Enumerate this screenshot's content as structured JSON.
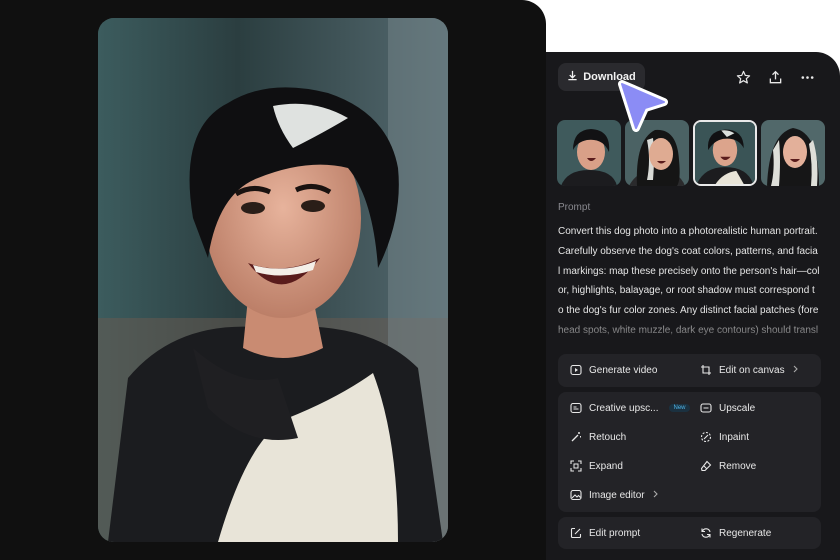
{
  "toolbar": {
    "download_label": "Download",
    "icons": [
      "star-icon",
      "share-icon",
      "more-icon"
    ]
  },
  "thumbnails": [
    {
      "name": "variation-1",
      "selected": false
    },
    {
      "name": "variation-2",
      "selected": false
    },
    {
      "name": "variation-3",
      "selected": true
    },
    {
      "name": "variation-4",
      "selected": false
    }
  ],
  "prompt": {
    "label": "Prompt",
    "text": "Convert this dog photo into a photorealistic human portrait. Carefully observe the dog's coat colors, patterns, and facial markings: map these precisely onto the person's hair—color, highlights, balayage, or root shadow must correspond to the dog's fur color zones. Any distinct facial patches (forehead spots, white muzzle, dark eye contours) should translate into freckles, birthmarks, or skin pigm"
  },
  "actions": {
    "generate_video": "Generate video",
    "edit_on_canvas": "Edit on canvas",
    "creative_upscale": "Creative upsc...",
    "new_badge": "New",
    "upscale": "Upscale",
    "retouch": "Retouch",
    "inpaint": "Inpaint",
    "expand": "Expand",
    "remove": "Remove",
    "image_editor": "Image editor",
    "edit_prompt": "Edit prompt",
    "regenerate": "Regenerate"
  },
  "colors": {
    "page_bg": "#101010",
    "panel_bg": "#18181b",
    "group_bg": "#232327",
    "cursor": "#8b8cf5",
    "badge": "#4fb5e8"
  }
}
